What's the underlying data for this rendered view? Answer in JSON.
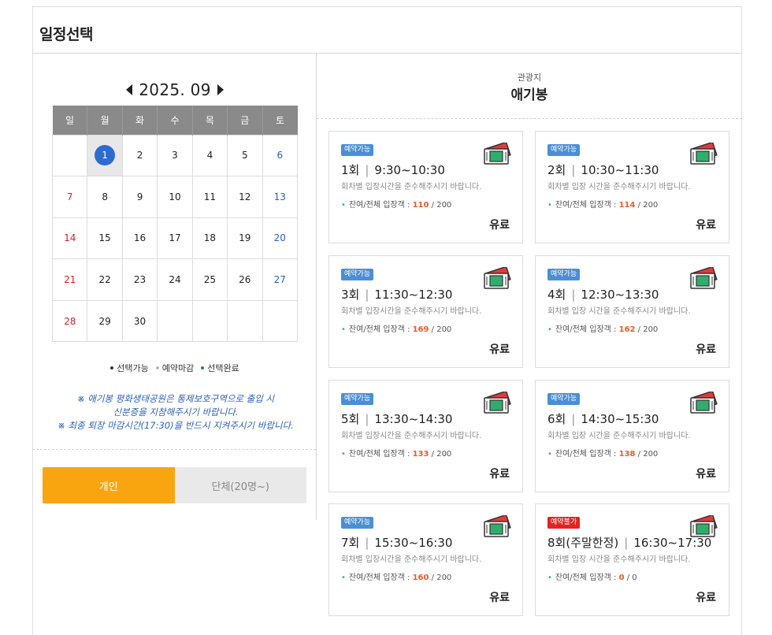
{
  "header": {
    "title": "일정선택"
  },
  "calendar": {
    "month_label": "2025. 09",
    "weekdays": [
      "일",
      "월",
      "화",
      "수",
      "목",
      "금",
      "토"
    ],
    "weeks": [
      [
        "",
        "1",
        "2",
        "3",
        "4",
        "5",
        "6"
      ],
      [
        "7",
        "8",
        "9",
        "10",
        "11",
        "12",
        "13"
      ],
      [
        "14",
        "15",
        "16",
        "17",
        "18",
        "19",
        "20"
      ],
      [
        "21",
        "22",
        "23",
        "24",
        "25",
        "26",
        "27"
      ],
      [
        "28",
        "29",
        "30",
        "",
        "",
        "",
        ""
      ]
    ],
    "selected_day": "1"
  },
  "legend": {
    "available": "선택가능",
    "closed": "예약마감",
    "selected": "선택완료",
    "colors": {
      "available": "#333333",
      "closed": "#bbbbbb",
      "selected": "#2e6bd0"
    }
  },
  "notice": {
    "line1": "※ 애기봉 평화생태공원은 통제보호구역으로 출입 시",
    "line2": "신분증을 지참해주시기 바랍니다.",
    "line3": "※ 최종 퇴장 마감시간(17:30)을 반드시 지켜주시기 바랍니다."
  },
  "toggle": {
    "individual": "개인",
    "group": "단체(20명~)"
  },
  "spot": {
    "category": "관광지",
    "name": "애기봉"
  },
  "colors": {
    "accent": "#f9a510",
    "badge_open": "#4a8fd4",
    "badge_closed": "#e32222",
    "remaining": "#f05a28"
  },
  "sessions": [
    {
      "badge": "예약가능",
      "round": "1회",
      "time": "9:30~10:30",
      "note": "회차별 입장시간을 준수해주시기 바랍니다.",
      "count_label": "잔여/전체 입장객 :",
      "remaining": "110",
      "total": "/ 200",
      "price": "유료"
    },
    {
      "badge": "예약가능",
      "round": "2회",
      "time": "10:30~11:30",
      "note": "회차별 입장 시간을 준수해주시기 바랍니다.",
      "count_label": "잔여/전체 입장객 :",
      "remaining": "114",
      "total": "/ 200",
      "price": "유료"
    },
    {
      "badge": "예약가능",
      "round": "3회",
      "time": "11:30~12:30",
      "note": "회차별 입장시간을 준수해주시기 바랍니다.",
      "count_label": "잔여/전체 입장객 :",
      "remaining": "169",
      "total": "/ 200",
      "price": "유료"
    },
    {
      "badge": "예약가능",
      "round": "4회",
      "time": "12:30~13:30",
      "note": "회차별 입장 시간을 준수해주시기 바랍니다.",
      "count_label": "잔여/전체 입장객 :",
      "remaining": "162",
      "total": "/ 200",
      "price": "유료"
    },
    {
      "badge": "예약가능",
      "round": "5회",
      "time": "13:30~14:30",
      "note": "회차별 입장시간을 준수해주시기 바랍니다.",
      "count_label": "잔여/전체 입장객 :",
      "remaining": "133",
      "total": "/ 200",
      "price": "유료"
    },
    {
      "badge": "예약가능",
      "round": "6회",
      "time": "14:30~15:30",
      "note": "회차별 입장 시간을 준수해주시기 바랍니다.",
      "count_label": "잔여/전체 입장객 :",
      "remaining": "138",
      "total": "/ 200",
      "price": "유료"
    },
    {
      "badge": "예약가능",
      "round": "7회",
      "time": "15:30~16:30",
      "note": "회차별 입장시간을 준수해주시기 바랍니다.",
      "count_label": "잔여/전체 입장객 :",
      "remaining": "160",
      "total": "/ 200",
      "price": "유료"
    },
    {
      "badge": "예약불가",
      "round": "8회(주말한정)",
      "time": "16:30~17:30",
      "note": "회차별 입장 시간을 준수해주시기 바랍니다.",
      "count_label": "잔여/전체 입장객 :",
      "remaining": "0",
      "total": "/ 0",
      "price": "유료"
    }
  ]
}
